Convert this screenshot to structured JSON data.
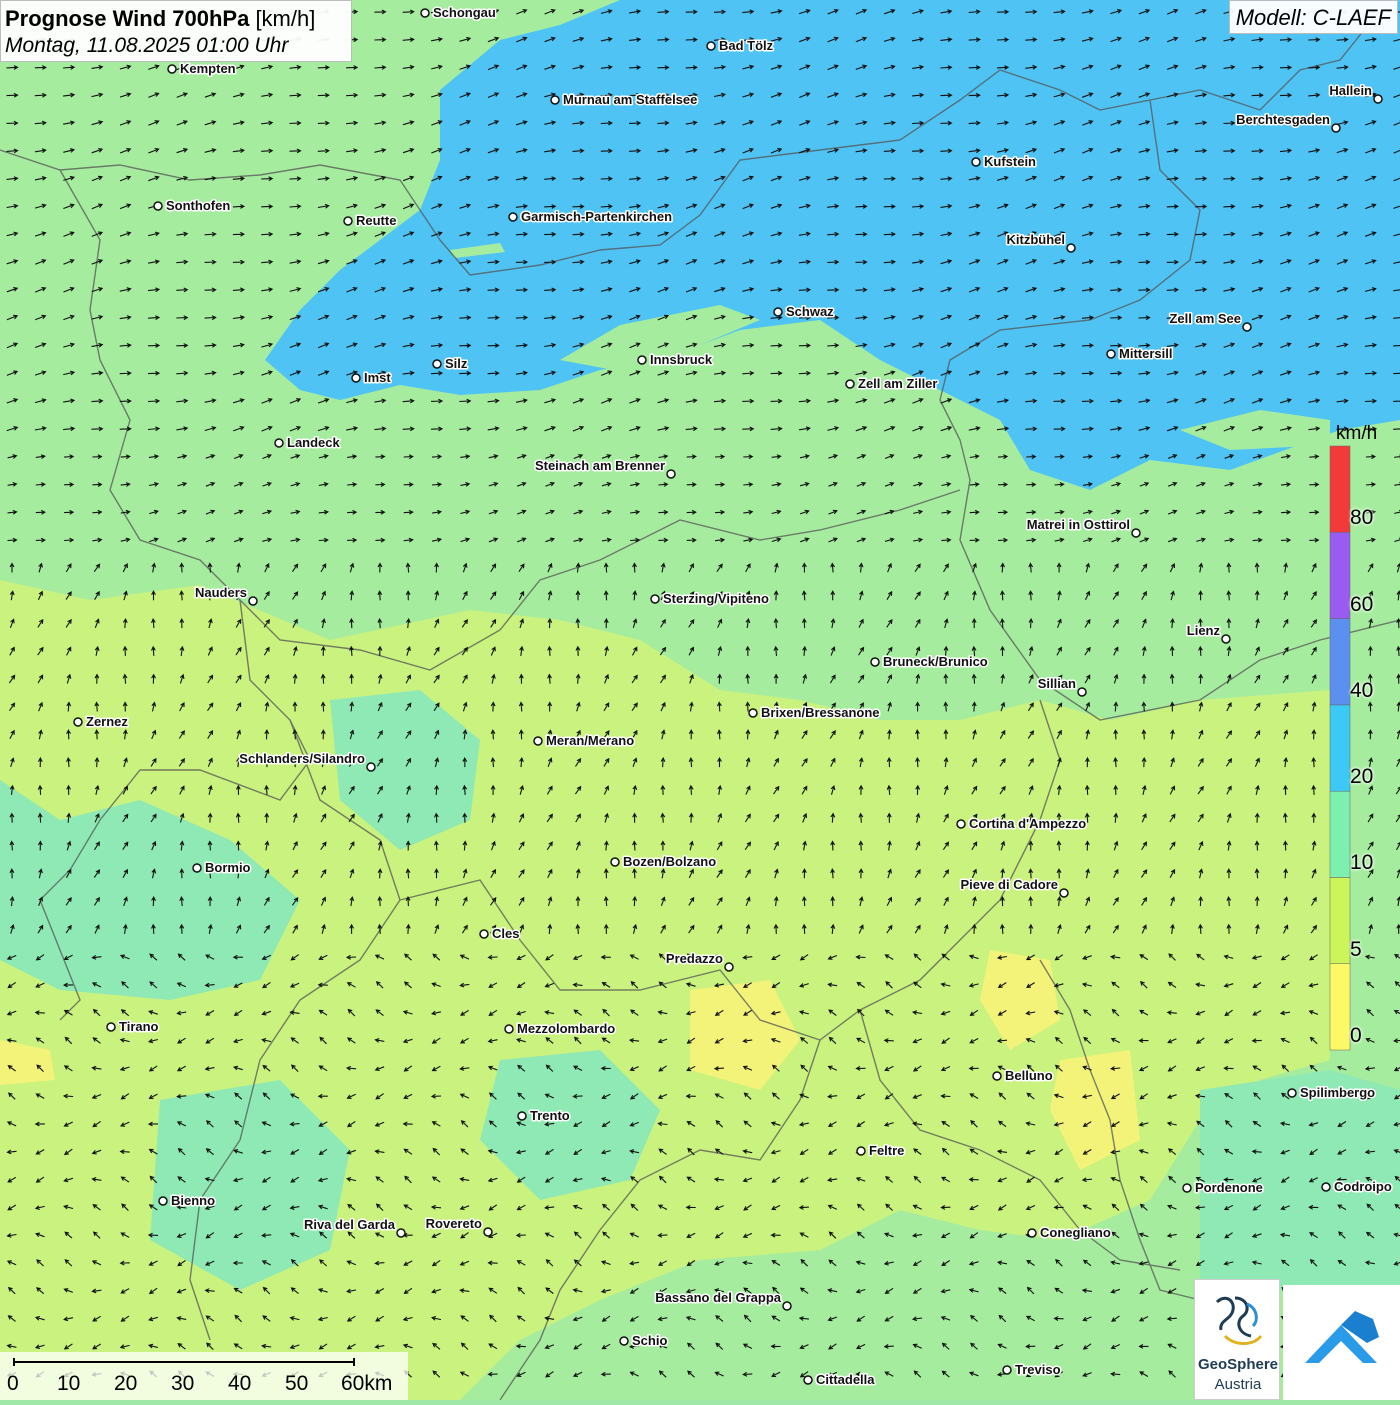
{
  "header": {
    "title_bold": "Prognose Wind 700hPa",
    "title_unit": "[km/h]",
    "date": "Montag, 11.08.2025 01:00 Uhr",
    "model": "Modell: C-LAEF"
  },
  "legend": {
    "unit": "km/h",
    "classes": [
      {
        "label": "0",
        "color": "#fdf866"
      },
      {
        "label": "5",
        "color": "#ccf55a"
      },
      {
        "label": "10",
        "color": "#7df0b0"
      },
      {
        "label": "20",
        "color": "#3cc9f5"
      },
      {
        "label": "40",
        "color": "#5b8ff0"
      },
      {
        "label": "60",
        "color": "#9a5cf0"
      },
      {
        "label": "80",
        "color": "#f23a3a"
      }
    ]
  },
  "cities": [
    {
      "name": "Schongau"
    },
    {
      "name": "Bad Tölz"
    },
    {
      "name": "Kempten"
    },
    {
      "name": "Murnau am Staffelsee"
    },
    {
      "name": "Hallein"
    },
    {
      "name": "Berchtesgaden"
    },
    {
      "name": "Kufstein"
    },
    {
      "name": "Sonthofen"
    },
    {
      "name": "Reutte"
    },
    {
      "name": "Garmisch-Partenkirchen"
    },
    {
      "name": "Kitzbühel"
    },
    {
      "name": "Schwaz"
    },
    {
      "name": "Zell am See"
    },
    {
      "name": "Mittersill"
    },
    {
      "name": "Imst"
    },
    {
      "name": "Silz"
    },
    {
      "name": "Innsbruck"
    },
    {
      "name": "Zell am Ziller"
    },
    {
      "name": "Landeck"
    },
    {
      "name": "Steinach am Brenner"
    },
    {
      "name": "Matrei in Osttirol"
    },
    {
      "name": "Nauders"
    },
    {
      "name": "Sterzing/Vipiteno"
    },
    {
      "name": "Lienz"
    },
    {
      "name": "Bruneck/Brunico"
    },
    {
      "name": "Sillian"
    },
    {
      "name": "Zernez"
    },
    {
      "name": "Brixen/Bressanone"
    },
    {
      "name": "Meran/Merano"
    },
    {
      "name": "Schlanders/Silandro"
    },
    {
      "name": "Cortina d'Ampezzo"
    },
    {
      "name": "Bozen/Bolzano"
    },
    {
      "name": "Bormio"
    },
    {
      "name": "Pieve di Cadore"
    },
    {
      "name": "Cles"
    },
    {
      "name": "Predazzo"
    },
    {
      "name": "Tirano"
    },
    {
      "name": "Mezzolombardo"
    },
    {
      "name": "Belluno"
    },
    {
      "name": "Spilimbergo"
    },
    {
      "name": "Trento"
    },
    {
      "name": "Feltre"
    },
    {
      "name": "Bienno"
    },
    {
      "name": "Pordenone"
    },
    {
      "name": "Codroipo"
    },
    {
      "name": "Riva del Garda"
    },
    {
      "name": "Rovereto"
    },
    {
      "name": "Conegliano"
    },
    {
      "name": "Bassano del Grappa"
    },
    {
      "name": "Schio"
    },
    {
      "name": "Treviso"
    },
    {
      "name": "Cittadella"
    }
  ],
  "scale_bar": {
    "ticks": [
      "0",
      "10",
      "20",
      "30",
      "40",
      "50",
      "60km"
    ]
  },
  "logos": {
    "geosphere_line1": "GeoSphere",
    "geosphere_line2": "Austria"
  }
}
